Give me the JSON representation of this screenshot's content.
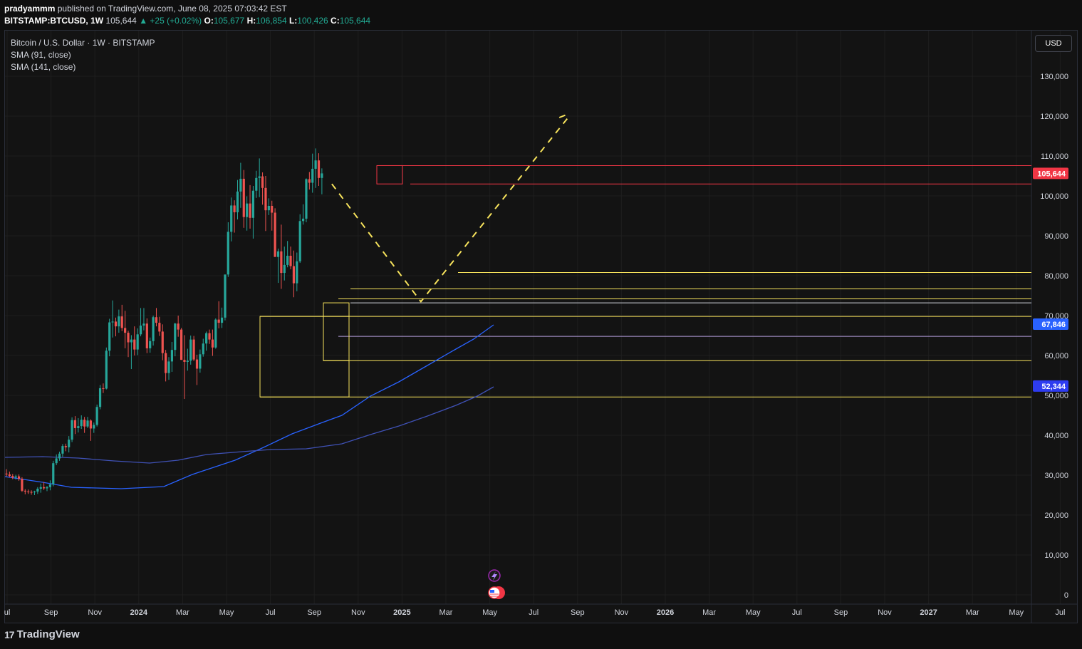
{
  "header": {
    "publisher": "pradyammm",
    "published_text": "published on TradingView.com, June 08, 2025 07:03:42 EST",
    "symbol": "BITSTAMP:BTCUSD, 1W",
    "last": "105,644",
    "change": "+25 (+0.02%)",
    "o_label": "O:",
    "o_value": "105,677",
    "h_label": "H:",
    "h_value": "106,854",
    "l_label": "L:",
    "l_value": "100,426",
    "c_label": "C:",
    "c_value": "105,644"
  },
  "legend": {
    "title": "Bitcoin / U.S. Dollar · 1W · BITSTAMP",
    "indicator_1": "SMA (91, close)",
    "indicator_2": "SMA (141, close)"
  },
  "currency_button": "USD",
  "brand": "TradingView",
  "colors": {
    "background": "#131313",
    "bull": "#26a69a",
    "bear": "#ef5350",
    "sma_91": "#2962ff",
    "sma_141": "#3f51b5",
    "zone": "#f7e35c",
    "resistance": "#f23645",
    "projection": "#f7e35c"
  },
  "price_labels": [
    {
      "text": "105,644",
      "value": 105644,
      "color": "#f23645"
    },
    {
      "text": "67,846",
      "value": 67846,
      "color": "#2962ff"
    },
    {
      "text": "52,344",
      "value": 52344,
      "color": "#2e3cf0"
    }
  ],
  "markers": [
    "lightning-event-icon",
    "us-flag-event-icon"
  ],
  "chart_data": {
    "type": "candlestick",
    "y_ticks": [
      "130,000",
      "120,000",
      "110,000",
      "100,000",
      "90,000",
      "80,000",
      "70,000",
      "60,000",
      "50,000",
      "40,000",
      "30,000",
      "20,000",
      "10,000",
      "0"
    ],
    "y_tick_values": [
      130000,
      120000,
      110000,
      100000,
      90000,
      80000,
      70000,
      60000,
      50000,
      40000,
      30000,
      20000,
      10000,
      0
    ],
    "x_ticks": [
      {
        "label": "ul",
        "bold": false
      },
      {
        "label": "Sep",
        "bold": false
      },
      {
        "label": "Nov",
        "bold": false
      },
      {
        "label": "2024",
        "bold": true
      },
      {
        "label": "Mar",
        "bold": false
      },
      {
        "label": "May",
        "bold": false
      },
      {
        "label": "Jul",
        "bold": false
      },
      {
        "label": "Sep",
        "bold": false
      },
      {
        "label": "Nov",
        "bold": false
      },
      {
        "label": "2025",
        "bold": true
      },
      {
        "label": "Mar",
        "bold": false
      },
      {
        "label": "May",
        "bold": false
      },
      {
        "label": "Jul",
        "bold": false
      },
      {
        "label": "Sep",
        "bold": false
      },
      {
        "label": "Nov",
        "bold": false
      },
      {
        "label": "2026",
        "bold": true
      },
      {
        "label": "Mar",
        "bold": false
      },
      {
        "label": "May",
        "bold": false
      },
      {
        "label": "Jul",
        "bold": false
      },
      {
        "label": "Sep",
        "bold": false
      },
      {
        "label": "Nov",
        "bold": false
      },
      {
        "label": "2027",
        "bold": true
      },
      {
        "label": "Mar",
        "bold": false
      },
      {
        "label": "May",
        "bold": false
      },
      {
        "label": "Jul",
        "bold": false
      }
    ],
    "ylim": [
      0,
      135000
    ],
    "horizontal_levels": [
      {
        "value": 107600,
        "color": "#f23645"
      },
      {
        "value": 103000,
        "color": "#f23645"
      },
      {
        "value": 80800,
        "color": "#f7e35c"
      },
      {
        "value": 76700,
        "color": "#f7e35c"
      },
      {
        "value": 74200,
        "color": "#f7e35c"
      },
      {
        "value": 73200,
        "color": "#d1d4dc"
      },
      {
        "value": 69800,
        "color": "#f7e35c"
      },
      {
        "value": 64800,
        "color": "#b39ddb"
      },
      {
        "value": 58700,
        "color": "#f7e35c"
      },
      {
        "value": 49600,
        "color": "#f7e35c"
      }
    ],
    "projection": [
      {
        "week": 0,
        "price": 103000
      },
      {
        "week": 15,
        "price": 73500
      },
      {
        "week": 40,
        "price": 120000
      }
    ],
    "candles_ohlc": [
      [
        30400,
        31500,
        29700,
        30200
      ],
      [
        30200,
        30900,
        29500,
        29800
      ],
      [
        29800,
        30300,
        29000,
        29400
      ],
      [
        29400,
        30100,
        28900,
        29700
      ],
      [
        29700,
        30200,
        28600,
        29100
      ],
      [
        29100,
        29500,
        25800,
        26100
      ],
      [
        26100,
        26500,
        25200,
        25900
      ],
      [
        25900,
        26400,
        25300,
        25800
      ],
      [
        25800,
        26200,
        25100,
        25700
      ],
      [
        25700,
        26100,
        25000,
        25900
      ],
      [
        25900,
        27000,
        25300,
        26600
      ],
      [
        26600,
        27900,
        25600,
        27000
      ],
      [
        27000,
        28300,
        26300,
        26700
      ],
      [
        26700,
        27300,
        26000,
        27000
      ],
      [
        27000,
        28700,
        26200,
        27700
      ],
      [
        27700,
        33600,
        27200,
        33000
      ],
      [
        33000,
        35200,
        32500,
        34200
      ],
      [
        34200,
        35900,
        33600,
        35400
      ],
      [
        35400,
        37800,
        34600,
        37300
      ],
      [
        37300,
        37900,
        36000,
        37000
      ],
      [
        37000,
        39800,
        35700,
        38900
      ],
      [
        38900,
        44500,
        38300,
        43800
      ],
      [
        43800,
        44800,
        40300,
        41800
      ],
      [
        41800,
        44300,
        40700,
        42300
      ],
      [
        42300,
        45000,
        41600,
        43900
      ],
      [
        43900,
        44600,
        40600,
        42200
      ],
      [
        42200,
        44600,
        41800,
        43700
      ],
      [
        43700,
        44000,
        38600,
        41700
      ],
      [
        41700,
        43200,
        40600,
        42600
      ],
      [
        42600,
        47700,
        42200,
        47100
      ],
      [
        47100,
        52600,
        46500,
        51800
      ],
      [
        51800,
        53000,
        50600,
        51700
      ],
      [
        51700,
        62000,
        51500,
        61200
      ],
      [
        61200,
        69200,
        59800,
        68300
      ],
      [
        68300,
        73800,
        64500,
        68500
      ],
      [
        68500,
        69500,
        64800,
        67300
      ],
      [
        67300,
        71500,
        65700,
        69800
      ],
      [
        69800,
        72700,
        66100,
        66900
      ],
      [
        66900,
        71200,
        61800,
        65700
      ],
      [
        65700,
        66200,
        59600,
        63300
      ],
      [
        63300,
        65100,
        56600,
        64000
      ],
      [
        64000,
        67300,
        60000,
        61500
      ],
      [
        61500,
        66800,
        60100,
        65300
      ],
      [
        65300,
        71900,
        64800,
        67500
      ],
      [
        67500,
        71900,
        66300,
        68000
      ],
      [
        68000,
        69300,
        60600,
        61800
      ],
      [
        61800,
        64500,
        60700,
        63600
      ],
      [
        63600,
        70000,
        62500,
        69600
      ],
      [
        69600,
        71900,
        67300,
        68200
      ],
      [
        68200,
        69700,
        64900,
        66000
      ],
      [
        66000,
        67800,
        58800,
        60600
      ],
      [
        60600,
        61400,
        53500,
        55600
      ],
      [
        55600,
        59600,
        53900,
        58500
      ],
      [
        58500,
        63400,
        55900,
        61400
      ],
      [
        61400,
        68200,
        59800,
        68000
      ],
      [
        68000,
        70000,
        64700,
        66500
      ],
      [
        66500,
        66900,
        58900,
        58900
      ],
      [
        58900,
        65100,
        49100,
        58400
      ],
      [
        58400,
        61700,
        56200,
        58700
      ],
      [
        58700,
        65000,
        57700,
        64000
      ],
      [
        64000,
        64900,
        58600,
        59000
      ],
      [
        59000,
        60200,
        52600,
        56700
      ],
      [
        56700,
        61500,
        55700,
        60300
      ],
      [
        60300,
        64200,
        59700,
        63000
      ],
      [
        63000,
        66000,
        61200,
        65600
      ],
      [
        65600,
        66500,
        62900,
        64000
      ],
      [
        64000,
        66500,
        59900,
        62000
      ],
      [
        62000,
        69300,
        61700,
        69000
      ],
      [
        69000,
        73600,
        66800,
        68200
      ],
      [
        68200,
        72000,
        66900,
        69500
      ],
      [
        69500,
        80000,
        68800,
        80300
      ],
      [
        80300,
        93400,
        79700,
        91000
      ],
      [
        91000,
        99600,
        88600,
        97600
      ],
      [
        97600,
        98900,
        90800,
        95900
      ],
      [
        95900,
        104000,
        94100,
        101100
      ],
      [
        101100,
        108300,
        97000,
        104300
      ],
      [
        104300,
        106500,
        92000,
        94700
      ],
      [
        94700,
        99900,
        91300,
        98100
      ],
      [
        98100,
        102700,
        91800,
        94500
      ],
      [
        94500,
        102500,
        89300,
        101300
      ],
      [
        101300,
        106300,
        99500,
        104500
      ],
      [
        104500,
        109400,
        99700,
        104900
      ],
      [
        104900,
        105900,
        97800,
        102000
      ],
      [
        102000,
        105000,
        91200,
        96400
      ],
      [
        96400,
        99400,
        95200,
        97500
      ],
      [
        97500,
        98800,
        91300,
        95800
      ],
      [
        95800,
        96900,
        84800,
        84700
      ],
      [
        84700,
        86800,
        78200,
        86100
      ],
      [
        86100,
        92800,
        76700,
        80700
      ],
      [
        80700,
        87300,
        78800,
        82700
      ],
      [
        82700,
        88700,
        82100,
        85000
      ],
      [
        85000,
        87300,
        81600,
        82400
      ],
      [
        82400,
        86300,
        74600,
        78100
      ],
      [
        78100,
        85800,
        76100,
        83600
      ],
      [
        83600,
        95400,
        83200,
        93700
      ],
      [
        93700,
        97900,
        92800,
        94300
      ],
      [
        94300,
        104400,
        93400,
        104200
      ],
      [
        104200,
        106000,
        101600,
        103300
      ],
      [
        103300,
        110600,
        100800,
        106800
      ],
      [
        106800,
        111900,
        102000,
        108900
      ],
      [
        108900,
        110700,
        102500,
        104500
      ],
      [
        104500,
        106900,
        100400,
        105644
      ]
    ],
    "sma_91_values": [
      67800
    ],
    "sma_141_values": [
      52300
    ],
    "last_close": 105644
  }
}
